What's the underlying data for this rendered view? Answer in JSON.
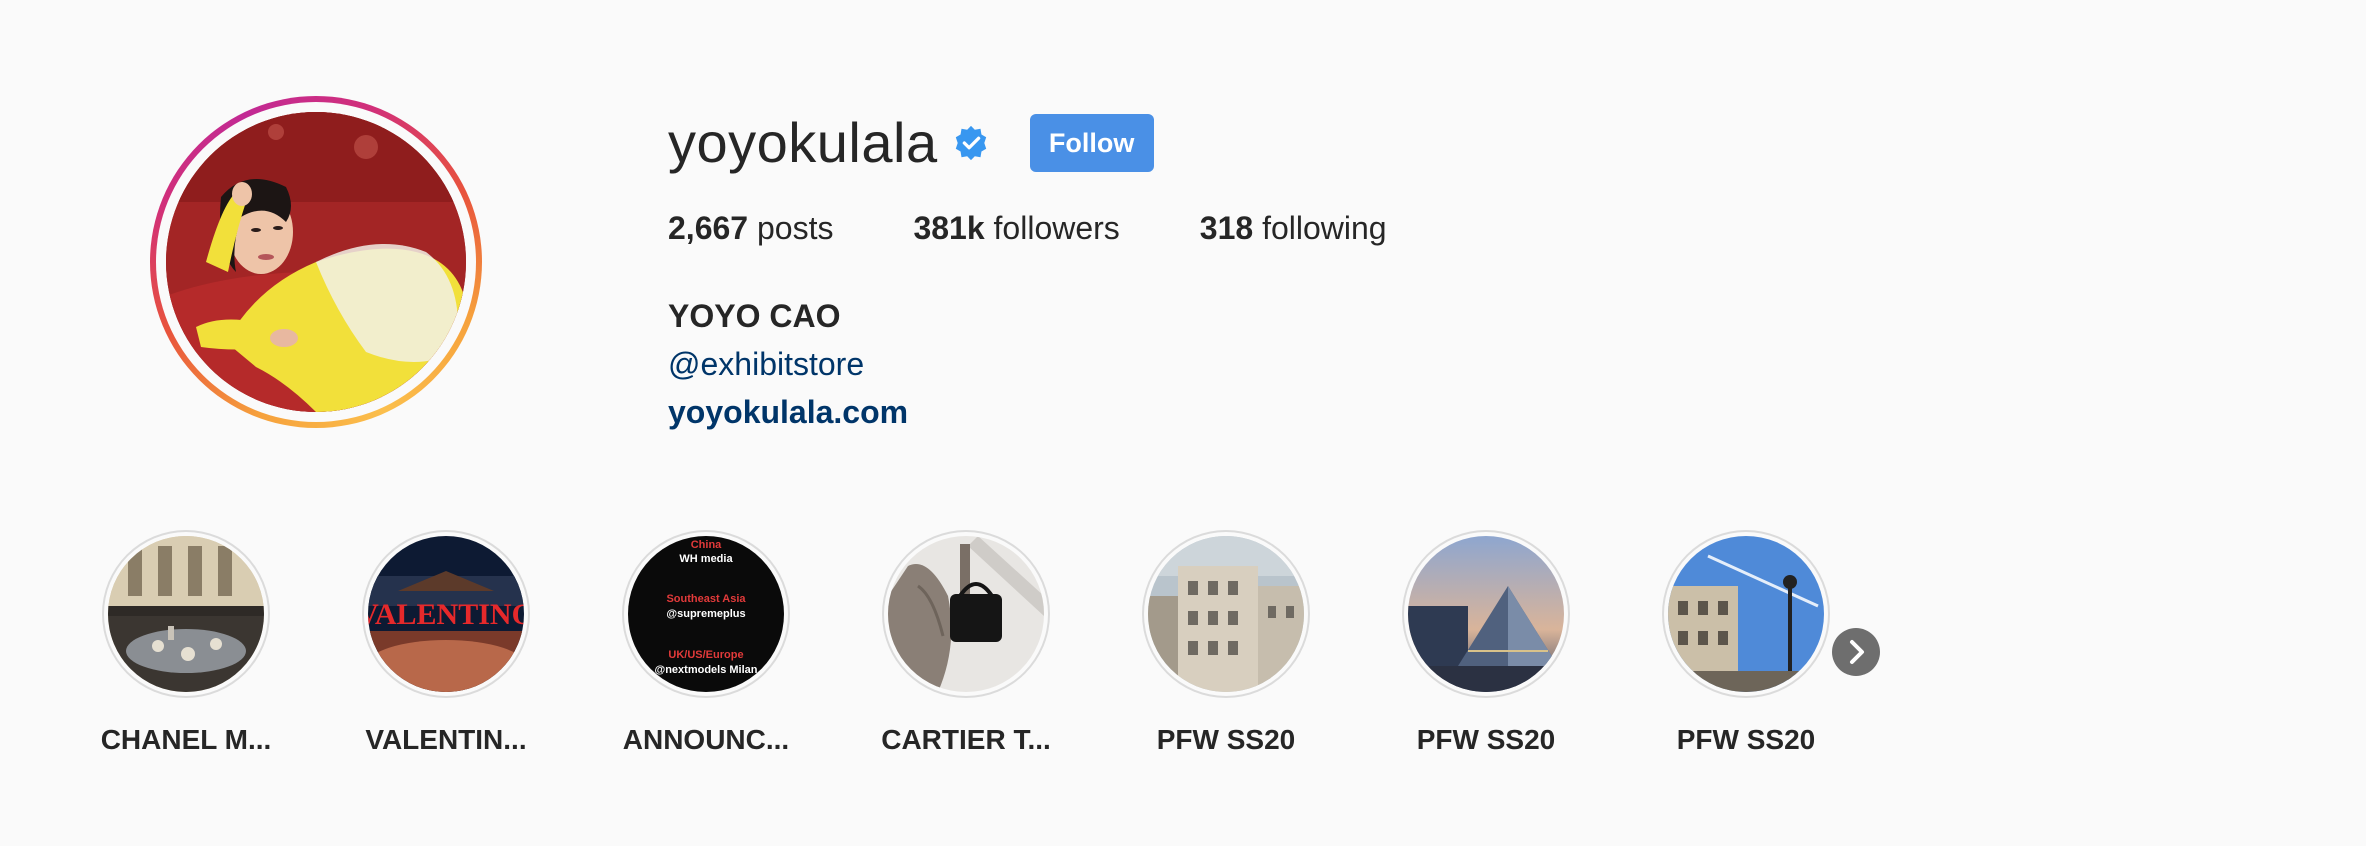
{
  "profile": {
    "username": "yoyokulala",
    "verified_icon": "verified-badge-icon",
    "follow_label": "Follow",
    "accent_color": "#4a90e6",
    "stats": {
      "posts_count": "2,667",
      "posts_label": " posts",
      "followers_count": "381k",
      "followers_label": " followers",
      "following_count": "318",
      "following_label": " following"
    },
    "bio": {
      "full_name": "YOYO CAO",
      "mention": "@exhibitstore",
      "website": "yoyokulala.com"
    }
  },
  "highlights": {
    "items": [
      {
        "label": "CHANEL M..."
      },
      {
        "label": "VALENTIN..."
      },
      {
        "label": "ANNOUNC..."
      },
      {
        "label": "CARTIER T..."
      },
      {
        "label": "PFW SS20"
      },
      {
        "label": "PFW SS20"
      },
      {
        "label": "PFW SS20"
      }
    ],
    "announcement_card": {
      "line1": "China",
      "line2": "WH media",
      "line3": "Southeast Asia",
      "line4": "@supremeplus",
      "line5": "UK/US/Europe",
      "line6": "@nextmodels Milan"
    },
    "valentino_sign": "VALENTINO",
    "next_icon": "chevron-right-icon"
  }
}
